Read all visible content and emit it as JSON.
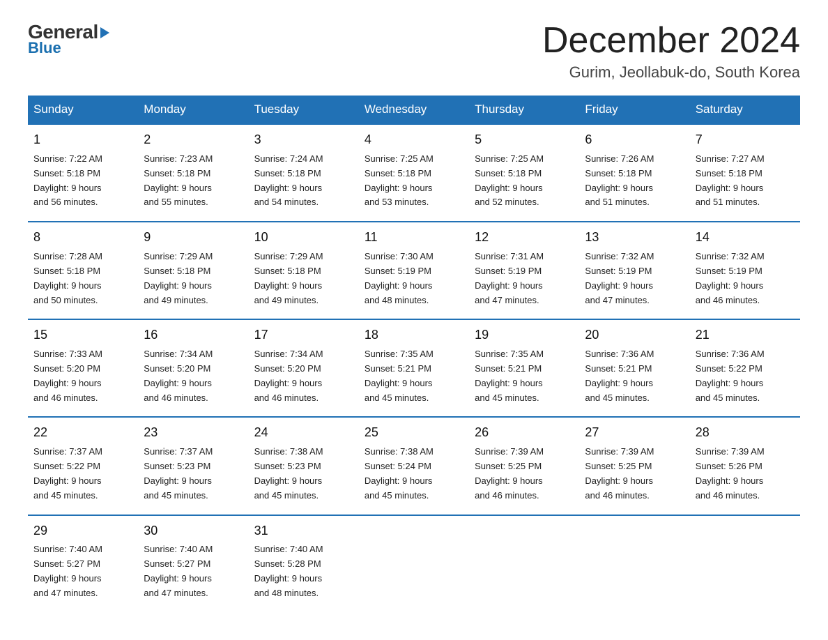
{
  "header": {
    "logo_general": "General",
    "logo_triangle_symbol": "▶",
    "logo_blue": "Blue",
    "calendar_title": "December 2024",
    "calendar_subtitle": "Gurim, Jeollabuk-do, South Korea"
  },
  "weekdays": [
    "Sunday",
    "Monday",
    "Tuesday",
    "Wednesday",
    "Thursday",
    "Friday",
    "Saturday"
  ],
  "weeks": [
    [
      {
        "day": "1",
        "sunrise": "7:22 AM",
        "sunset": "5:18 PM",
        "daylight": "9 hours and 56 minutes."
      },
      {
        "day": "2",
        "sunrise": "7:23 AM",
        "sunset": "5:18 PM",
        "daylight": "9 hours and 55 minutes."
      },
      {
        "day": "3",
        "sunrise": "7:24 AM",
        "sunset": "5:18 PM",
        "daylight": "9 hours and 54 minutes."
      },
      {
        "day": "4",
        "sunrise": "7:25 AM",
        "sunset": "5:18 PM",
        "daylight": "9 hours and 53 minutes."
      },
      {
        "day": "5",
        "sunrise": "7:25 AM",
        "sunset": "5:18 PM",
        "daylight": "9 hours and 52 minutes."
      },
      {
        "day": "6",
        "sunrise": "7:26 AM",
        "sunset": "5:18 PM",
        "daylight": "9 hours and 51 minutes."
      },
      {
        "day": "7",
        "sunrise": "7:27 AM",
        "sunset": "5:18 PM",
        "daylight": "9 hours and 51 minutes."
      }
    ],
    [
      {
        "day": "8",
        "sunrise": "7:28 AM",
        "sunset": "5:18 PM",
        "daylight": "9 hours and 50 minutes."
      },
      {
        "day": "9",
        "sunrise": "7:29 AM",
        "sunset": "5:18 PM",
        "daylight": "9 hours and 49 minutes."
      },
      {
        "day": "10",
        "sunrise": "7:29 AM",
        "sunset": "5:18 PM",
        "daylight": "9 hours and 49 minutes."
      },
      {
        "day": "11",
        "sunrise": "7:30 AM",
        "sunset": "5:19 PM",
        "daylight": "9 hours and 48 minutes."
      },
      {
        "day": "12",
        "sunrise": "7:31 AM",
        "sunset": "5:19 PM",
        "daylight": "9 hours and 47 minutes."
      },
      {
        "day": "13",
        "sunrise": "7:32 AM",
        "sunset": "5:19 PM",
        "daylight": "9 hours and 47 minutes."
      },
      {
        "day": "14",
        "sunrise": "7:32 AM",
        "sunset": "5:19 PM",
        "daylight": "9 hours and 46 minutes."
      }
    ],
    [
      {
        "day": "15",
        "sunrise": "7:33 AM",
        "sunset": "5:20 PM",
        "daylight": "9 hours and 46 minutes."
      },
      {
        "day": "16",
        "sunrise": "7:34 AM",
        "sunset": "5:20 PM",
        "daylight": "9 hours and 46 minutes."
      },
      {
        "day": "17",
        "sunrise": "7:34 AM",
        "sunset": "5:20 PM",
        "daylight": "9 hours and 46 minutes."
      },
      {
        "day": "18",
        "sunrise": "7:35 AM",
        "sunset": "5:21 PM",
        "daylight": "9 hours and 45 minutes."
      },
      {
        "day": "19",
        "sunrise": "7:35 AM",
        "sunset": "5:21 PM",
        "daylight": "9 hours and 45 minutes."
      },
      {
        "day": "20",
        "sunrise": "7:36 AM",
        "sunset": "5:21 PM",
        "daylight": "9 hours and 45 minutes."
      },
      {
        "day": "21",
        "sunrise": "7:36 AM",
        "sunset": "5:22 PM",
        "daylight": "9 hours and 45 minutes."
      }
    ],
    [
      {
        "day": "22",
        "sunrise": "7:37 AM",
        "sunset": "5:22 PM",
        "daylight": "9 hours and 45 minutes."
      },
      {
        "day": "23",
        "sunrise": "7:37 AM",
        "sunset": "5:23 PM",
        "daylight": "9 hours and 45 minutes."
      },
      {
        "day": "24",
        "sunrise": "7:38 AM",
        "sunset": "5:23 PM",
        "daylight": "9 hours and 45 minutes."
      },
      {
        "day": "25",
        "sunrise": "7:38 AM",
        "sunset": "5:24 PM",
        "daylight": "9 hours and 45 minutes."
      },
      {
        "day": "26",
        "sunrise": "7:39 AM",
        "sunset": "5:25 PM",
        "daylight": "9 hours and 46 minutes."
      },
      {
        "day": "27",
        "sunrise": "7:39 AM",
        "sunset": "5:25 PM",
        "daylight": "9 hours and 46 minutes."
      },
      {
        "day": "28",
        "sunrise": "7:39 AM",
        "sunset": "5:26 PM",
        "daylight": "9 hours and 46 minutes."
      }
    ],
    [
      {
        "day": "29",
        "sunrise": "7:40 AM",
        "sunset": "5:27 PM",
        "daylight": "9 hours and 47 minutes."
      },
      {
        "day": "30",
        "sunrise": "7:40 AM",
        "sunset": "5:27 PM",
        "daylight": "9 hours and 47 minutes."
      },
      {
        "day": "31",
        "sunrise": "7:40 AM",
        "sunset": "5:28 PM",
        "daylight": "9 hours and 48 minutes."
      },
      null,
      null,
      null,
      null
    ]
  ]
}
